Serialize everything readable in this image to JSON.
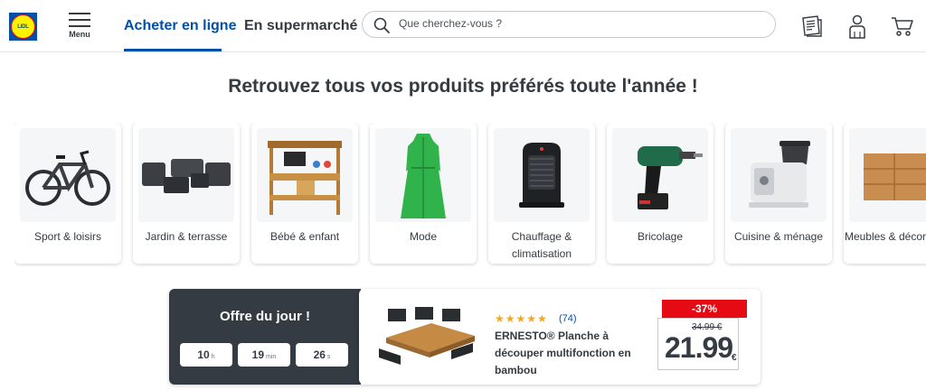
{
  "header": {
    "logo_text": "LIDL",
    "menu_label": "Menu",
    "tabs": [
      {
        "label": "Acheter en ligne",
        "active": true
      },
      {
        "label": "En supermarché",
        "active": false
      }
    ],
    "search_placeholder": "Que cherchez-vous ?",
    "icons": [
      "leaflet-icon",
      "user-icon",
      "cart-icon"
    ]
  },
  "headline": "Retrouvez tous vos produits préférés toute l'année !",
  "categories": [
    {
      "label": "Sport & loisirs",
      "icon": "bicycle"
    },
    {
      "label": "Jardin & terrasse",
      "icon": "garden-furniture"
    },
    {
      "label": "Bébé & enfant",
      "icon": "play-kitchen"
    },
    {
      "label": "Mode",
      "icon": "dress"
    },
    {
      "label": "Chauffage & climatisation",
      "icon": "heater"
    },
    {
      "label": "Bricolage",
      "icon": "drill"
    },
    {
      "label": "Cuisine & ménage",
      "icon": "food-processor"
    },
    {
      "label": "Meubles & décoration",
      "icon": "sideboard"
    }
  ],
  "deal": {
    "title": "Offre du jour !",
    "timer": [
      {
        "value": "10",
        "unit": "h"
      },
      {
        "value": "19",
        "unit": "min"
      },
      {
        "value": "26",
        "unit": "s"
      }
    ],
    "product": {
      "rating_stars": "★★★★★",
      "reviews": "(74)",
      "name": "ERNESTO® Planche à découper multifonction en bambou",
      "discount": "-37%",
      "old_price": "34.99 €",
      "price": "21.99",
      "currency": "€"
    }
  },
  "colors": {
    "brand_blue": "#0050aa",
    "brand_yellow": "#fff100",
    "brand_red": "#e60a14",
    "dark": "#353b42",
    "star": "#f6a623"
  }
}
